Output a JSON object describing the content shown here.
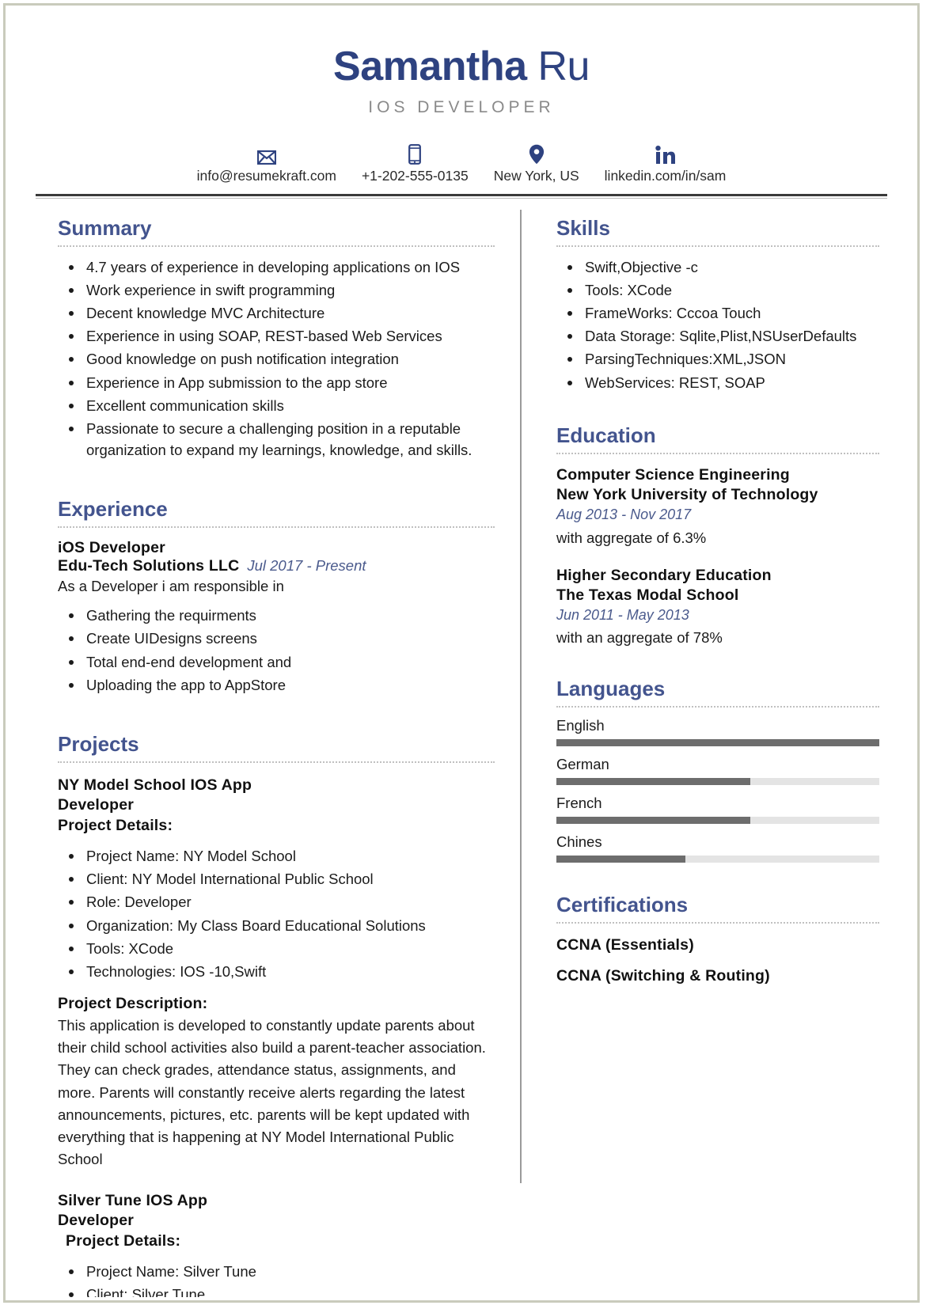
{
  "header": {
    "first_name": "Samantha",
    "last_name": "Ru",
    "job_title": "IOS DEVELOPER",
    "accent_color": "#2e4280",
    "contacts": [
      {
        "icon": "email-icon",
        "text": "info@resumekraft.com"
      },
      {
        "icon": "phone-icon",
        "text": "+1-202-555-0135"
      },
      {
        "icon": "location-icon",
        "text": "New York, US"
      },
      {
        "icon": "linkedin-icon",
        "text": "linkedin.com/in/sam"
      }
    ]
  },
  "summary": {
    "heading": "Summary",
    "items": [
      "4.7 years of experience in developing applications on IOS",
      "Work experience in swift programming",
      "Decent knowledge MVC Architecture",
      "Experience in using SOAP, REST-based Web Services",
      "Good knowledge on push notification integration",
      "Experience in App submission to the app store",
      "Excellent communication skills",
      "Passionate to secure a challenging position in a reputable organization to expand my learnings, knowledge, and skills."
    ]
  },
  "experience": {
    "heading": "Experience",
    "role": "iOS Developer",
    "company": "Edu-Tech Solutions LLC",
    "dates": "Jul 2017 - Present",
    "intro": "As a Developer i am responsible in",
    "items": [
      "Gathering the requirments",
      "Create UIDesigns  screens",
      "Total end-end  development and",
      "Uploading the app to AppStore"
    ]
  },
  "projects": {
    "heading": "Projects",
    "items": [
      {
        "title": "NY Model School IOS App",
        "role": "Developer",
        "details_label": "Project Details:",
        "details": [
          "Project Name: NY Model School",
          "Client: NY Model International Public School",
          "Role: Developer",
          "Organization: My Class Board Educational Solutions",
          "Tools: XCode",
          "Technologies: IOS -10,Swift"
        ],
        "description_label": "Project Description:",
        "description": "This application is developed to constantly update parents about their child school activities also build a parent-teacher association. They can check grades, attendance status, assignments, and more. Parents will constantly receive alerts regarding the latest announcements, pictures, etc. parents will be kept updated with everything that is happening at NY Model International Public School"
      },
      {
        "title": "Silver Tune IOS App",
        "role": "Developer",
        "details_label": "Project Details:",
        "details": [
          "Project Name: Silver Tune",
          "Client: Silver Tune"
        ]
      }
    ]
  },
  "skills": {
    "heading": "Skills",
    "items": [
      "Swift,Objective -c",
      "Tools: XCode",
      "FrameWorks: Cccoa Touch",
      "Data Storage: Sqlite,Plist,NSUserDefaults",
      "ParsingTechniques:XML,JSON",
      "WebServices: REST, SOAP"
    ]
  },
  "education": {
    "heading": "Education",
    "items": [
      {
        "degree": "Computer Science Engineering",
        "school": "New York University of Technology",
        "dates": "Aug 2013 - Nov 2017",
        "note": "with aggregate of 6.3%"
      },
      {
        "degree": "Higher Secondary Education",
        "school": "The Texas Modal School",
        "dates": "Jun 2011 - May 2013",
        "note": "with an aggregate of 78%"
      }
    ]
  },
  "languages": {
    "heading": "Languages",
    "bar_fill_color": "#6d6d6d",
    "bar_track_color": "#e4e4e4",
    "items": [
      {
        "name": "English",
        "level": 100
      },
      {
        "name": "German",
        "level": 60
      },
      {
        "name": "French",
        "level": 60
      },
      {
        "name": "Chines",
        "level": 40
      }
    ]
  },
  "certifications": {
    "heading": "Certifications",
    "items": [
      "CCNA (Essentials)",
      "CCNA (Switching & Routing)"
    ]
  }
}
